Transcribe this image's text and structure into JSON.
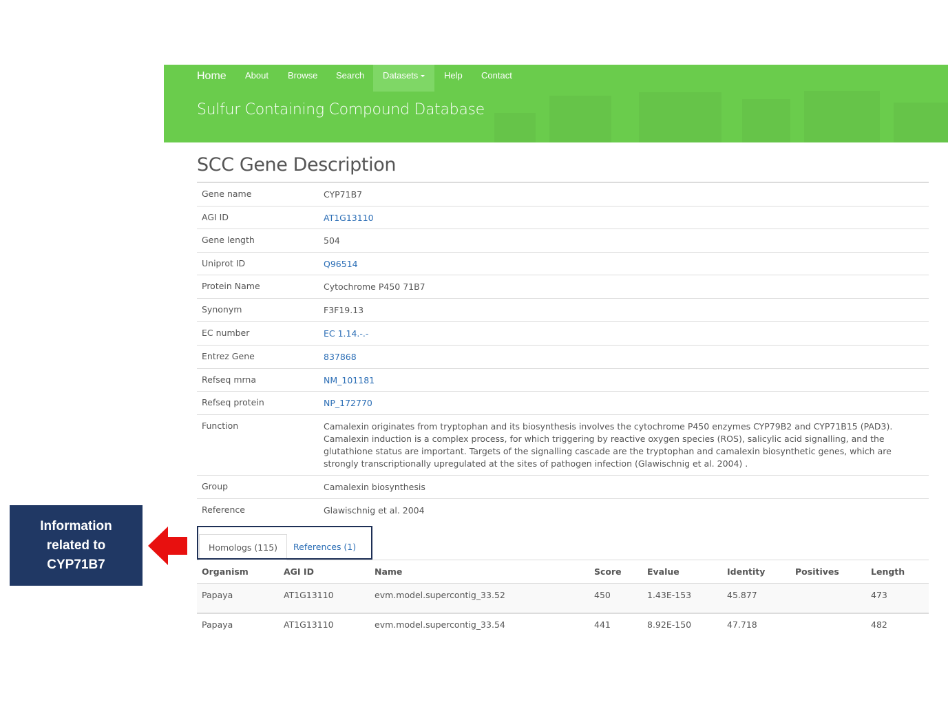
{
  "nav": {
    "home": "Home",
    "about": "About",
    "browse": "Browse",
    "search": "Search",
    "datasets": "Datasets",
    "help": "Help",
    "contact": "Contact"
  },
  "site_title": "Sulfur Containing Compound Database",
  "page_title": "SCC Gene Description",
  "gene": {
    "gene_name_label": "Gene name",
    "gene_name": "CYP71B7",
    "agi_label": "AGI ID",
    "agi": "AT1G13110",
    "length_label": "Gene length",
    "length": "504",
    "uniprot_label": "Uniprot ID",
    "uniprot": "Q96514",
    "protein_label": "Protein Name",
    "protein": "Cytochrome P450 71B7",
    "synonym_label": "Synonym",
    "synonym": "F3F19.13",
    "ec_label": "EC number",
    "ec": "EC 1.14.-.-",
    "entrez_label": "Entrez Gene",
    "entrez": "837868",
    "mrna_label": "Refseq mrna",
    "mrna": "NM_101181",
    "refprot_label": "Refseq protein",
    "refprot": "NP_172770",
    "function_label": "Function",
    "function": "Camalexin originates from tryptophan and its biosynthesis involves the cytochrome P450 enzymes CYP79B2 and CYP71B15 (PAD3). Camalexin induction is a complex process, for which triggering by reactive oxygen species (ROS), salicylic acid signalling, and the glutathione status are important. Targets of the signalling cascade are the tryptophan and camalexin biosynthetic genes, which are strongly transcriptionally upregulated at the sites of pathogen infection (Glawischnig et al. 2004) .",
    "group_label": "Group",
    "group": "Camalexin biosynthesis",
    "reference_label": "Reference",
    "reference": "Glawischnig et al. 2004"
  },
  "tabs": {
    "homologs": "Homologs (115)",
    "references": "References (1)"
  },
  "homologs": {
    "headers": [
      "Organism",
      "AGI ID",
      "Name",
      "Score",
      "Evalue",
      "Identity",
      "Positives",
      "Length"
    ],
    "rows": [
      [
        "Papaya",
        "AT1G13110",
        "evm.model.supercontig_33.52",
        "450",
        "1.43E-153",
        "45.877",
        "",
        "473"
      ],
      [
        "Papaya",
        "AT1G13110",
        "evm.model.supercontig_33.54",
        "441",
        "8.92E-150",
        "47.718",
        "",
        "482"
      ]
    ]
  },
  "callout": {
    "line1": "Information",
    "line2": "related to",
    "line3": "CYP71B7"
  },
  "colors": {
    "header_green": "#6acc4c",
    "link_blue": "#2a6db5",
    "callout_navy": "#203864",
    "arrow_red": "#e8100f"
  }
}
